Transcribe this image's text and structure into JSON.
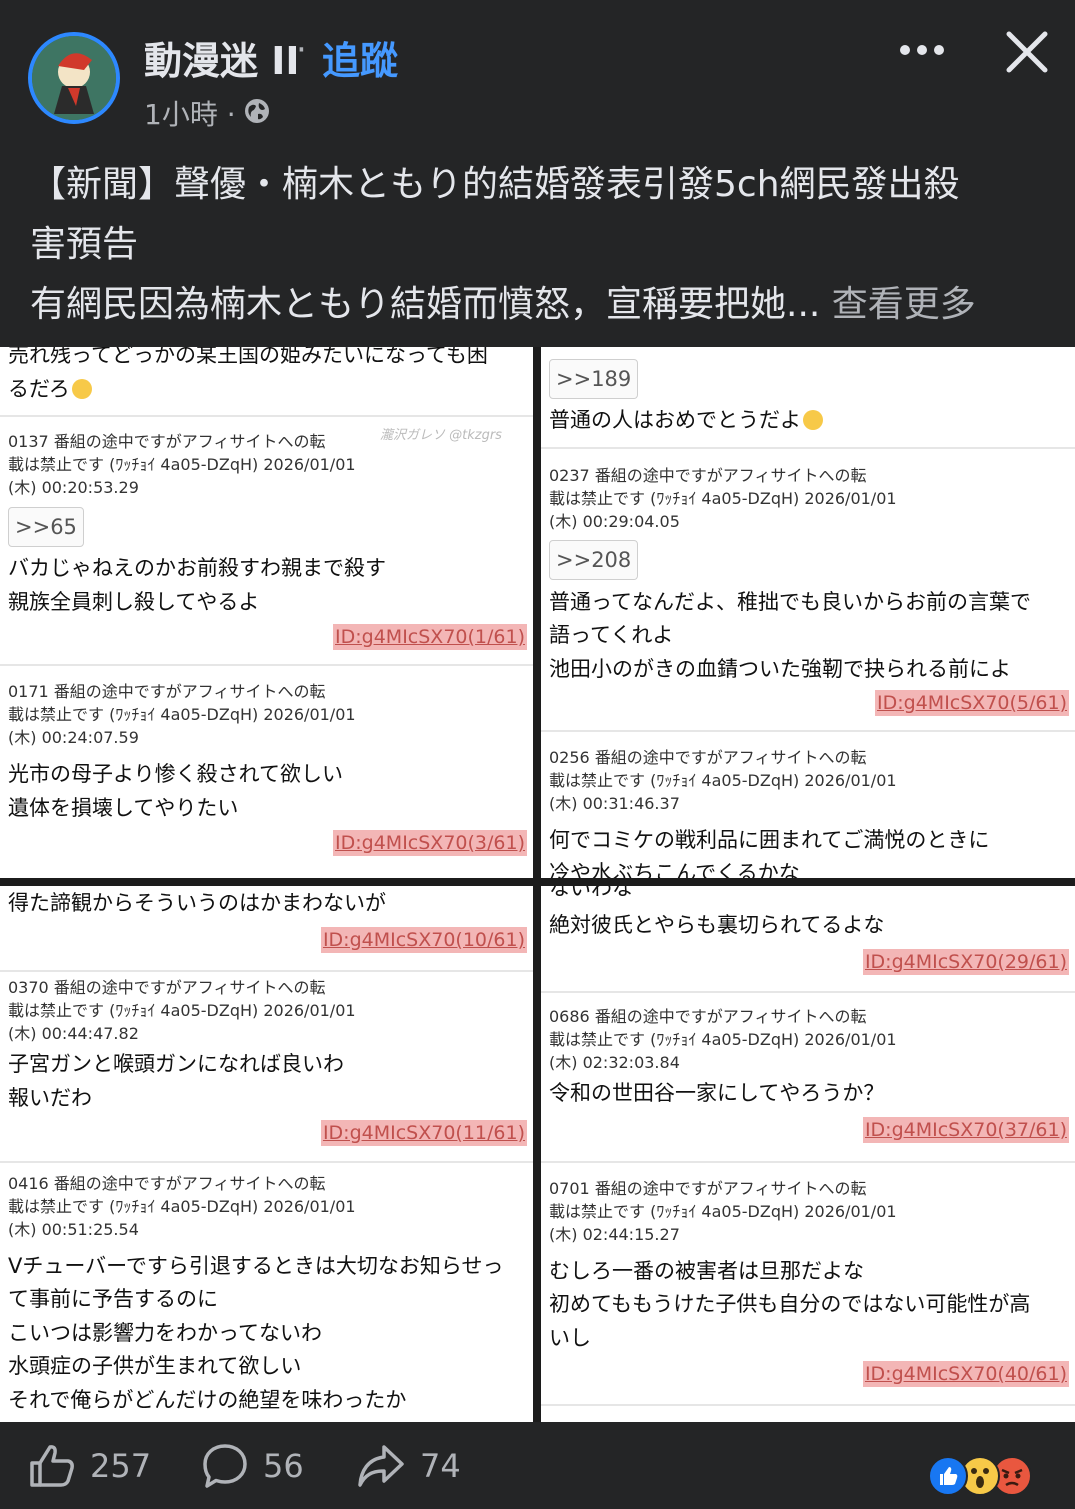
{
  "header": {
    "page_name": "動漫迷 II",
    "separator": "·",
    "follow_label": "追蹤",
    "time": "1小時 ·"
  },
  "caption": {
    "line1": "【新聞】聲優・楠木ともり的結婚發表引發5ch網民發出殺",
    "line2": "害預告",
    "line3": "有網民因為楠木ともり結婚而憤怒，宣稱要把她...",
    "see_more": "查看更多"
  },
  "panels": {
    "top_left": {
      "partial1": "売れ残ってどっかの某王国の姫みたいになっても困",
      "partial2": "るだろ",
      "watermark": "瀧沢ガレソ @tkzgrs",
      "posts": [
        {
          "h1": "0137 番組の途中ですがアフィサイトへの転",
          "h2": "載は禁止です (ﾜｯﾁｮｲ 4a05-DZqH) 2026/01/01",
          "h3": "(木) 00:20:53.29",
          "reply": ">>65",
          "l1": "バカじゃねえのかお前殺すわ親まで殺す",
          "l2": "親族全員刺し殺してやるよ",
          "id": "ID:g4MIcSX70(1/61)"
        },
        {
          "h1": "0171 番組の途中ですがアフィサイトへの転",
          "h2": "載は禁止です (ﾜｯﾁｮｲ 4a05-DZqH) 2026/01/01",
          "h3": "(木) 00:24:07.59",
          "l1": "光市の母子より惨く殺されて欲しい",
          "l2": "遺体を損壊してやりたい",
          "id": "ID:g4MIcSX70(3/61)"
        }
      ]
    },
    "top_right": {
      "reply0": ">>189",
      "line0": "普通の人はおめでとうだよ",
      "posts": [
        {
          "h1": "0237 番組の途中ですがアフィサイトへの転",
          "h2": "載は禁止です (ﾜｯﾁｮｲ 4a05-DZqH) 2026/01/01",
          "h3": "(木) 00:29:04.05",
          "reply": ">>208",
          "l1": "普通ってなんだよ、稚拙でも良いからお前の言葉で",
          "l2": "語ってくれよ",
          "l3": "池田小のがきの血錆ついた強靭で抉られる前によ",
          "id": "ID:g4MIcSX70(5/61)"
        },
        {
          "h1": "0256 番組の途中ですがアフィサイトへの転",
          "h2": "載は禁止です (ﾜｯﾁｮｲ 4a05-DZqH) 2026/01/01",
          "h3": "(木) 00:31:46.37",
          "l1": "何でコミケの戦利品に囲まれてご満悦のときに",
          "l2": "冷や水ぶちこんでくるかな"
        }
      ]
    },
    "bottom_left": {
      "partial1": "得た諦観からそういうのはかまわないが",
      "id0": "ID:g4MIcSX70(10/61)",
      "posts": [
        {
          "h1": "0370 番組の途中ですがアフィサイトへの転",
          "h2": "載は禁止です (ﾜｯﾁｮｲ 4a05-DZqH) 2026/01/01",
          "h3": "(木) 00:44:47.82",
          "l1": "子宮ガンと喉頭ガンになれば良いわ",
          "l2": "報いだわ",
          "id": "ID:g4MIcSX70(11/61)"
        },
        {
          "h1": "0416 番組の途中ですがアフィサイトへの転",
          "h2": "載は禁止です (ﾜｯﾁｮｲ 4a05-DZqH) 2026/01/01",
          "h3": "(木) 00:51:25.54",
          "l1": "Vチューバーですら引退するときは大切なお知らせっ",
          "l2": "て事前に予告するのに",
          "l3": "こいつは影響力をわかってないわ",
          "l4": "水頭症の子供が生まれて欲しい",
          "l5": "それで俺らがどんだけの絶望を味わったか"
        }
      ]
    },
    "bottom_right": {
      "partial1": "ないわな",
      "line0": "絶対彼氏とやらも裏切られてるよな",
      "id0": "ID:g4MIcSX70(29/61)",
      "posts": [
        {
          "h1": "0686 番組の途中ですがアフィサイトへの転",
          "h2": "載は禁止です (ﾜｯﾁｮｲ 4a05-DZqH) 2026/01/01",
          "h3": "(木) 02:32:03.84",
          "l1": "令和の世田谷一家にしてやろうか？",
          "id": "ID:g4MIcSX70(37/61)"
        },
        {
          "h1": "0701 番組の途中ですがアフィサイトへの転",
          "h2": "載は禁止です (ﾜｯﾁｮｲ 4a05-DZqH) 2026/01/01",
          "h3": "(木) 02:44:15.27",
          "l1": "むしろ一番の被害者は旦那だよな",
          "l2": "初めてももうけた子供も自分のではない可能性が高",
          "l3": "いし",
          "id": "ID:g4MIcSX70(40/61)"
        }
      ]
    }
  },
  "footer": {
    "likes": "257",
    "comments": "56",
    "shares": "74"
  },
  "colors": {
    "background": "#242526",
    "link_blue": "#4599ff",
    "id_highlight": "#f3b6b6",
    "like_blue": "#1877f2",
    "wow_yellow": "#f7c948",
    "angry_red": "#e9573f"
  },
  "icons": [
    "avatar-image",
    "globe-icon",
    "more-options-icon",
    "close-icon",
    "thumbs-up-icon",
    "comment-icon",
    "share-icon",
    "like-reaction-icon",
    "wow-reaction-icon",
    "angry-reaction-icon"
  ]
}
